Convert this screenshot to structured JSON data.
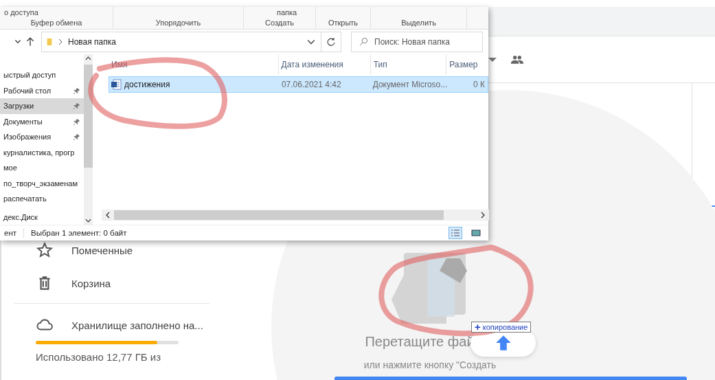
{
  "drive": {
    "sidebar": [
      {
        "kind": "starred",
        "label": "Помеченные"
      },
      {
        "kind": "trash",
        "label": "Корзина"
      }
    ],
    "storage": {
      "label": "Хранилище заполнено на...",
      "level": 0.85,
      "usage": "Использовано 12,77 ГБ из"
    },
    "drop_zone": {
      "title": "Перетащите фай",
      "subtitle": "или нажмите кнопку \"Создать"
    },
    "drag_tooltip": {
      "icon": "+",
      "label": "копирование"
    }
  },
  "explorer": {
    "ribbon": [
      {
        "top": "о доступа",
        "label": "Буфер обмена"
      },
      {
        "label": "Упорядочить"
      },
      {
        "top": "папка",
        "label": "Создать"
      },
      {
        "label": "Открыть"
      },
      {
        "label": "Выделить"
      }
    ],
    "address": "Новая папка",
    "search": {
      "placeholder": "Поиск: Новая папка"
    },
    "nav": [
      {
        "label": "ыстрый доступ",
        "pinned": false,
        "selected": false
      },
      {
        "label": "Рабочий стол",
        "pinned": true,
        "selected": false
      },
      {
        "label": "Загрузки",
        "pinned": true,
        "selected": true
      },
      {
        "label": "Документы",
        "pinned": true,
        "selected": false
      },
      {
        "label": "Изображения",
        "pinned": true,
        "selected": false
      },
      {
        "label": "курналистика, прогр",
        "pinned": false,
        "selected": false
      },
      {
        "label": "мое",
        "pinned": false,
        "selected": false
      },
      {
        "label": "по_творч_экзаменам",
        "pinned": false,
        "selected": false
      },
      {
        "label": "распечатать",
        "pinned": false,
        "selected": false
      },
      {
        "label": "декс.Диск",
        "pinned": false,
        "selected": false
      }
    ],
    "columns": [
      "Имя",
      "Дата изменения",
      "Тип",
      "Размер"
    ],
    "rows": [
      {
        "name": "достижения",
        "date": "07.06.2021 4:42",
        "type": "Документ Microso...",
        "size": "0 К",
        "selected": true
      }
    ],
    "status": {
      "fragment": "ент",
      "selection": "Выбран 1 элемент: 0 байт"
    },
    "views": [
      {
        "kind": "details",
        "selected": true
      },
      {
        "kind": "tiles",
        "selected": false
      }
    ]
  }
}
